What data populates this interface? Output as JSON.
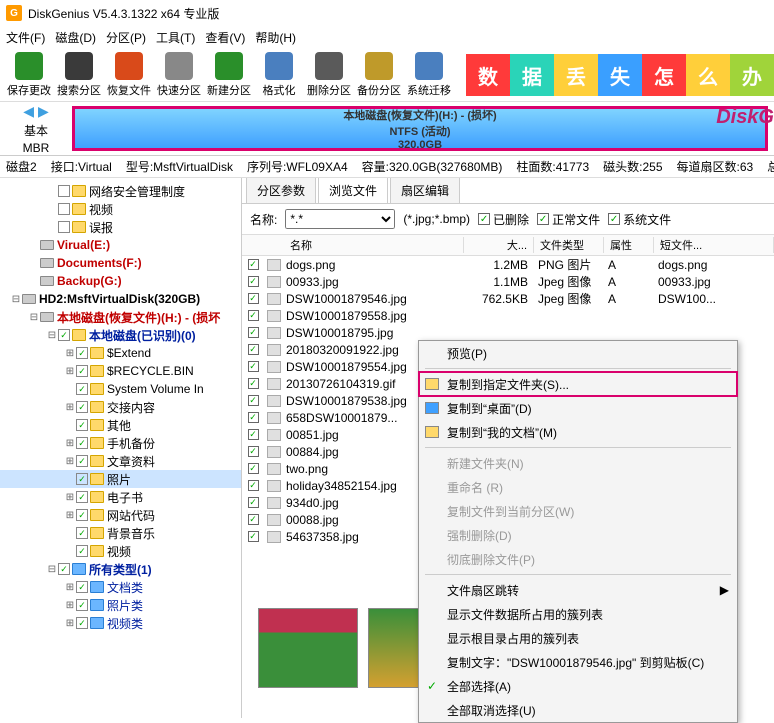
{
  "title": "DiskGenius V5.4.3.1322 x64 专业版",
  "menu": [
    "文件(F)",
    "磁盘(D)",
    "分区(P)",
    "工具(T)",
    "查看(V)",
    "帮助(H)"
  ],
  "toolbar": [
    "保存更改",
    "搜索分区",
    "恢复文件",
    "快速分区",
    "新建分区",
    "格式化",
    "删除分区",
    "备份分区",
    "系统迁移"
  ],
  "banner_chars": [
    "数",
    "据",
    "丢",
    "失",
    "怎",
    "么",
    "办"
  ],
  "dg_logo": "DiskG",
  "disk_hdr": {
    "basic": "基本",
    "mbr": "MBR",
    "line1": "本地磁盘(恢复文件)(H:) - (损坏)",
    "line2": "NTFS (活动)",
    "line3": "320.0GB"
  },
  "status": [
    "磁盘2",
    "接口:Virtual",
    "型号:MsftVirtualDisk",
    "序列号:WFL09XA4",
    "容量:320.0GB(327680MB)",
    "柱面数:41773",
    "磁头数:255",
    "每道扇区数:63",
    "总扇区"
  ],
  "tree": [
    {
      "ind": 46,
      "exp": "",
      "chk": "",
      "fold": "y",
      "label": "网络安全管理制度"
    },
    {
      "ind": 46,
      "exp": "",
      "chk": "",
      "fold": "y",
      "label": "视频"
    },
    {
      "ind": 46,
      "exp": "",
      "chk": "",
      "fold": "y",
      "label": "误报"
    },
    {
      "ind": 28,
      "exp": "",
      "chk": "",
      "disk": true,
      "label": "Virual(E:)",
      "cls": "bold red"
    },
    {
      "ind": 28,
      "exp": "",
      "chk": "",
      "disk": true,
      "label": "Documents(F:)",
      "cls": "bold red"
    },
    {
      "ind": 28,
      "exp": "",
      "chk": "",
      "disk": true,
      "label": "Backup(G:)",
      "cls": "bold red"
    },
    {
      "ind": 10,
      "exp": "⊟",
      "chk": "",
      "disk": true,
      "label": "HD2:MsftVirtualDisk(320GB)",
      "cls": "bold"
    },
    {
      "ind": 28,
      "exp": "⊟",
      "chk": "",
      "disk": true,
      "label": "本地磁盘(恢复文件)(H:) - (损坏",
      "cls": "bold red"
    },
    {
      "ind": 46,
      "exp": "⊟",
      "chk": "✓",
      "fold": "y",
      "label": "本地磁盘(已识别)(0)",
      "cls": "bold blue-txt"
    },
    {
      "ind": 64,
      "exp": "⊞",
      "chk": "✓",
      "fold": "y",
      "label": "$Extend"
    },
    {
      "ind": 64,
      "exp": "⊞",
      "chk": "✓",
      "fold": "y",
      "label": "$RECYCLE.BIN"
    },
    {
      "ind": 64,
      "exp": "",
      "chk": "✓",
      "fold": "y",
      "label": "System Volume In"
    },
    {
      "ind": 64,
      "exp": "⊞",
      "chk": "✓",
      "fold": "y",
      "label": "交接内容"
    },
    {
      "ind": 64,
      "exp": "",
      "chk": "✓",
      "fold": "y",
      "label": "其他"
    },
    {
      "ind": 64,
      "exp": "⊞",
      "chk": "✓",
      "fold": "y",
      "label": "手机备份"
    },
    {
      "ind": 64,
      "exp": "⊞",
      "chk": "✓",
      "fold": "y",
      "label": "文章资料"
    },
    {
      "ind": 64,
      "exp": "",
      "chk": "✓",
      "fold": "y",
      "label": "照片",
      "sel": true
    },
    {
      "ind": 64,
      "exp": "⊞",
      "chk": "✓",
      "fold": "y",
      "label": "电子书"
    },
    {
      "ind": 64,
      "exp": "⊞",
      "chk": "✓",
      "fold": "y",
      "label": "网站代码"
    },
    {
      "ind": 64,
      "exp": "",
      "chk": "✓",
      "fold": "y",
      "label": "背景音乐"
    },
    {
      "ind": 64,
      "exp": "",
      "chk": "✓",
      "fold": "y",
      "label": "视频"
    },
    {
      "ind": 46,
      "exp": "⊟",
      "chk": "✓",
      "fold": "b",
      "label": "所有类型(1)",
      "cls": "bold blue-txt"
    },
    {
      "ind": 64,
      "exp": "⊞",
      "chk": "✓",
      "fold": "b",
      "label": "文档类",
      "cls": "blue-txt"
    },
    {
      "ind": 64,
      "exp": "⊞",
      "chk": "✓",
      "fold": "b",
      "label": "照片类",
      "cls": "blue-txt"
    },
    {
      "ind": 64,
      "exp": "⊞",
      "chk": "✓",
      "fold": "b",
      "label": "视频类",
      "cls": "blue-txt"
    }
  ],
  "tabs": [
    "分区参数",
    "浏览文件",
    "扇区编辑"
  ],
  "filter": {
    "name_label": "名称:",
    "pattern": "*.*",
    "wildcard": "(*.jpg;*.bmp)",
    "deleted": "已删除",
    "normal": "正常文件",
    "system": "系统文件"
  },
  "cols": {
    "name": "名称",
    "size": "大...",
    "type": "文件类型",
    "attr": "属性",
    "short": "短文件..."
  },
  "files": [
    {
      "n": "dogs.png",
      "s": "1.2MB",
      "t": "PNG 图片",
      "a": "A",
      "sh": "dogs.png"
    },
    {
      "n": "00933.jpg",
      "s": "1.1MB",
      "t": "Jpeg 图像",
      "a": "A",
      "sh": "00933.jpg"
    },
    {
      "n": "DSW10001879546.jpg",
      "s": "762.5KB",
      "t": "Jpeg 图像",
      "a": "A",
      "sh": "DSW100..."
    },
    {
      "n": "DSW10001879558.jpg",
      "s": "",
      "t": "",
      "a": "",
      "sh": ""
    },
    {
      "n": "DSW100018795.jpg",
      "s": "",
      "t": "",
      "a": "",
      "sh": ""
    },
    {
      "n": "20180320091922.jpg",
      "s": "",
      "t": "",
      "a": "",
      "sh": ""
    },
    {
      "n": "DSW10001879554.jpg",
      "s": "",
      "t": "",
      "a": "",
      "sh": ""
    },
    {
      "n": "20130726104319.gif",
      "s": "",
      "t": "",
      "a": "",
      "sh": ""
    },
    {
      "n": "DSW10001879538.jpg",
      "s": "",
      "t": "",
      "a": "",
      "sh": ""
    },
    {
      "n": "658DSW10001879...",
      "s": "",
      "t": "",
      "a": "",
      "sh": ""
    },
    {
      "n": "00851.jpg",
      "s": "",
      "t": "",
      "a": "",
      "sh": ""
    },
    {
      "n": "00884.jpg",
      "s": "",
      "t": "",
      "a": "",
      "sh": ""
    },
    {
      "n": "two.png",
      "s": "",
      "t": "",
      "a": "",
      "sh": ""
    },
    {
      "n": "holiday34852154.jpg",
      "s": "",
      "t": "",
      "a": "",
      "sh": ""
    },
    {
      "n": "934d0.jpg",
      "s": "",
      "t": "",
      "a": "",
      "sh": ""
    },
    {
      "n": "00088.jpg",
      "s": "",
      "t": "",
      "a": "",
      "sh": ""
    },
    {
      "n": "54637358.jpg",
      "s": "",
      "t": "",
      "a": "",
      "sh": ""
    }
  ],
  "ctx": [
    {
      "t": "预览(P)",
      "sep": false
    },
    {
      "sep": true
    },
    {
      "t": "复制到指定文件夹(S)...",
      "hl": true,
      "icon": "#ffd96b"
    },
    {
      "t": "复制到“桌面”(D)",
      "icon": "#3fa0ff"
    },
    {
      "t": "复制到“我的文档”(M)",
      "icon": "#ffd96b"
    },
    {
      "sep": true
    },
    {
      "t": "新建文件夹(N)",
      "dis": true
    },
    {
      "t": "重命名 (R)",
      "dis": true
    },
    {
      "t": "复制文件到当前分区(W)",
      "dis": true
    },
    {
      "t": "强制删除(D)",
      "dis": true
    },
    {
      "t": "彻底删除文件(P)",
      "dis": true
    },
    {
      "sep": true
    },
    {
      "t": "文件扇区跳转",
      "arrow": true
    },
    {
      "t": "显示文件数据所占用的簇列表"
    },
    {
      "t": "显示根目录占用的簇列表"
    },
    {
      "t": "复制文字：\"DSW10001879546.jpg\" 到剪贴板(C)"
    },
    {
      "t": "全部选择(A)",
      "chk": true
    },
    {
      "t": "全部取消选择(U)"
    }
  ],
  "tool_colors": [
    "#2a8f2a",
    "#3a3a3a",
    "#d94a1a",
    "#888",
    "#2a8f2a",
    "#4a7fbf",
    "#5a5a5a",
    "#bf9a2a",
    "#4a7fbf"
  ],
  "banner_bg": [
    "#ff3a3a",
    "#2ad4b8",
    "#ffcf3a",
    "#3a9fff",
    "#ff3a3a",
    "#ffcf3a",
    "#a0d43a"
  ]
}
